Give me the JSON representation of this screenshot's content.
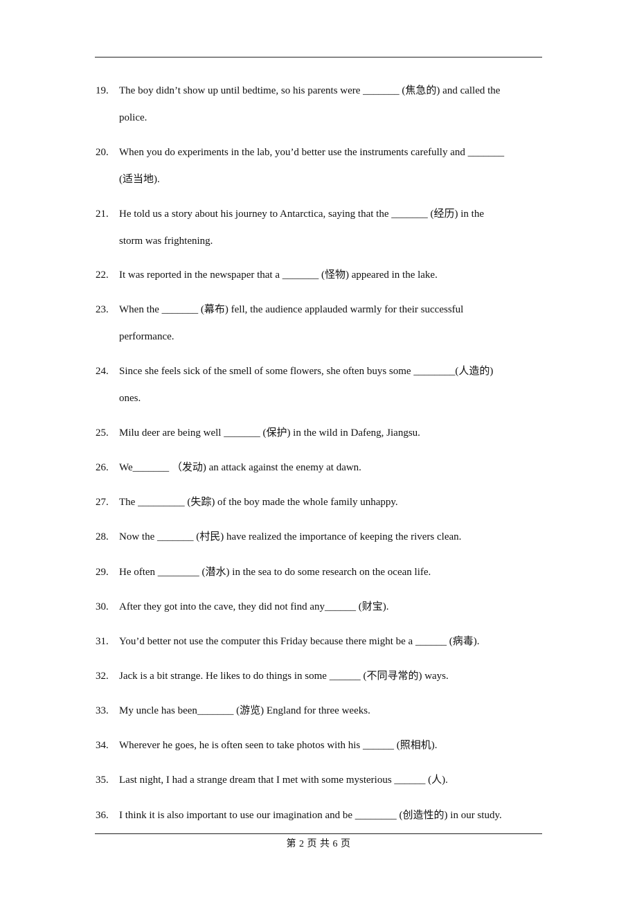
{
  "page": {
    "footer": "第 2 页 共 6 页"
  },
  "questions": [
    {
      "num": "19.",
      "lines": [
        "The boy didn’t show up until bedtime, so his parents were _______    (焦急的) and called the",
        "police."
      ]
    },
    {
      "num": "20.",
      "lines": [
        "When you do experiments in the lab, you’d better use the instruments carefully and _______",
        "(适当地)."
      ]
    },
    {
      "num": "21.",
      "lines": [
        "He told us a story about his journey to Antarctica, saying that the _______     (经历) in the",
        "storm was frightening."
      ]
    },
    {
      "num": "22.",
      "lines": [
        " It was reported in the newspaper that a _______    (怪物) appeared in the lake."
      ]
    },
    {
      "num": "23.",
      "lines": [
        "When the _______    (幕布) fell, the audience applauded warmly for their successful",
        "performance."
      ]
    },
    {
      "num": "24.",
      "lines": [
        " Since she feels sick of the smell of some flowers, she often buys some ________(人造的)",
        "ones."
      ]
    },
    {
      "num": "25.",
      "lines": [
        "Milu deer are being well _______      (保护) in the wild in Dafeng, Jiangsu."
      ]
    },
    {
      "num": "26.",
      "lines": [
        " We_______    （发动) an attack against the enemy at dawn."
      ]
    },
    {
      "num": "27.",
      "lines": [
        "The _________     (失踪) of the boy made the whole family unhappy."
      ]
    },
    {
      "num": "28.",
      "lines": [
        " Now the _______     (村民) have realized the importance of keeping the rivers clean."
      ]
    },
    {
      "num": "29.",
      "lines": [
        "He often ________     (潜水) in the sea to do some research on the ocean life."
      ]
    },
    {
      "num": "30.",
      "lines": [
        "After they got into the cave, they did not find any______     (财宝)."
      ]
    },
    {
      "num": "31.",
      "lines": [
        "You’d better not use the computer this Friday because there might be a ______   (病毒)."
      ]
    },
    {
      "num": "32.",
      "lines": [
        "Jack is a bit strange. He likes to do things in some ______      (不同寻常的) ways."
      ]
    },
    {
      "num": "33.",
      "lines": [
        "My uncle has been_______    (游览) England for three weeks."
      ]
    },
    {
      "num": "34.",
      "lines": [
        "Wherever he goes, he is often seen to take photos with his ______     (照相机)."
      ]
    },
    {
      "num": "35.",
      "lines": [
        "Last night, I had a strange dream that I met with some mysterious ______    (人)."
      ]
    },
    {
      "num": "36.",
      "lines": [
        "I think it is also important to use our imagination and be ________   (创造性的) in our study."
      ]
    }
  ]
}
